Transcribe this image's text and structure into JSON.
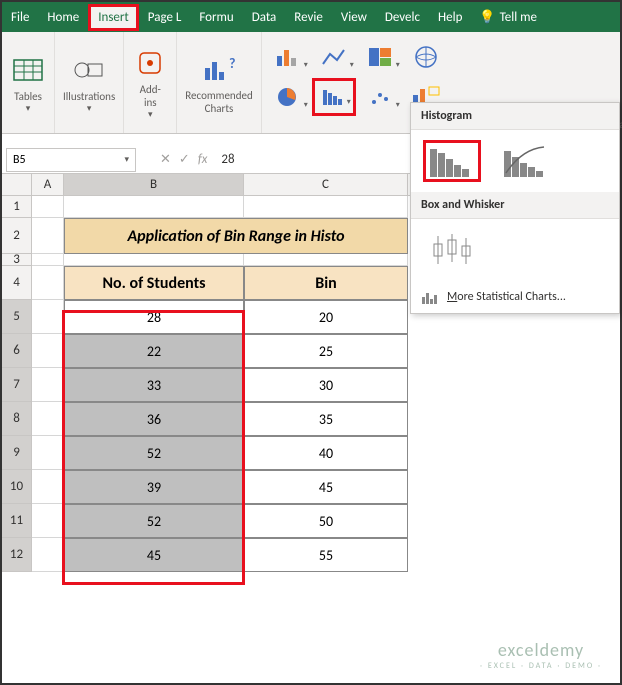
{
  "tabs": {
    "file": "File",
    "home": "Home",
    "insert": "Insert",
    "pagel": "Page L",
    "formu": "Formu",
    "data": "Data",
    "revie": "Revie",
    "view": "View",
    "develc": "Develc",
    "help": "Help",
    "tellme": "Tell me"
  },
  "ribbon": {
    "tables": "Tables",
    "illustrations": "Illustrations",
    "addins": "Add-ins",
    "recommended": "Recommended\nCharts",
    "maps": "Maps",
    "pivotchart": "PivotChart"
  },
  "dropdown": {
    "histogram": "Histogram",
    "boxwhisker": "Box and Whisker",
    "more": "More Statistical Charts...",
    "more_u": "M"
  },
  "formula": {
    "namebox": "B5",
    "fx": "fx",
    "value": "28",
    "x": "✕",
    "check": "✓"
  },
  "cols": {
    "a": "A",
    "b": "B",
    "c": "C"
  },
  "rows": [
    "1",
    "2",
    "3",
    "4",
    "5",
    "6",
    "7",
    "8",
    "9",
    "10",
    "11",
    "12"
  ],
  "table": {
    "title": "Application of Bin Range in Histo",
    "h1": "No. of Students",
    "h2": "Bin",
    "students": [
      "28",
      "22",
      "33",
      "36",
      "52",
      "39",
      "52",
      "45"
    ],
    "bins": [
      "20",
      "25",
      "30",
      "35",
      "40",
      "45",
      "50",
      "55"
    ]
  },
  "watermark": {
    "brand": "exceldemy",
    "tag": "· EXCEL · DATA · DEMO ·"
  }
}
